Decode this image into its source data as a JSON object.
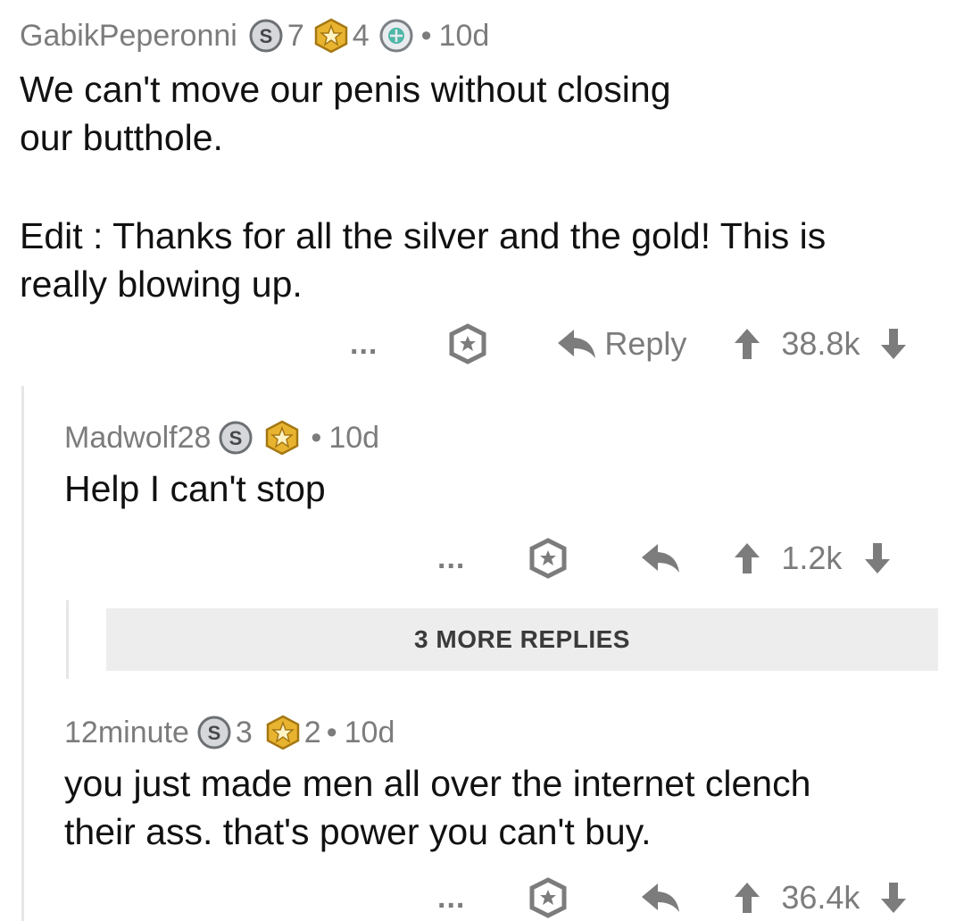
{
  "comments": [
    {
      "username": "GabikPeperonni",
      "silver_count": "7",
      "gold_count": "4",
      "time": "10d",
      "lines": [
        "We can't move our penis without closing",
        "our butthole.",
        "",
        "Edit : Thanks for all the silver and the gold! This is",
        "really blowing up."
      ],
      "more": "...",
      "reply_label": "Reply",
      "score": "38.8k"
    },
    {
      "username": "Madwolf28",
      "time": "10d",
      "lines": [
        "Help I can't stop"
      ],
      "more": "...",
      "score": "1.2k"
    },
    {
      "username": "12minute",
      "silver_count": "3",
      "gold_count": "2",
      "time": "10d",
      "lines": [
        "you just made men all over the internet clench",
        "their ass. that's power you can't buy."
      ],
      "more": "...",
      "score": "36.4k"
    }
  ],
  "more_replies_label": "3 MORE REPLIES",
  "dot_separator": "•",
  "icons": {
    "silver": "silver-award-icon",
    "gold": "gold-award-icon",
    "platinum": "platinum-award-icon",
    "give_award": "give-award-icon",
    "reply": "reply-arrow-icon",
    "upvote": "upvote-arrow-icon",
    "downvote": "downvote-arrow-icon"
  },
  "colors": {
    "meta": "#7c7c7c",
    "gold": "#e8b430",
    "silver": "#9aa0a6",
    "platinum": "#4fb7a8"
  }
}
